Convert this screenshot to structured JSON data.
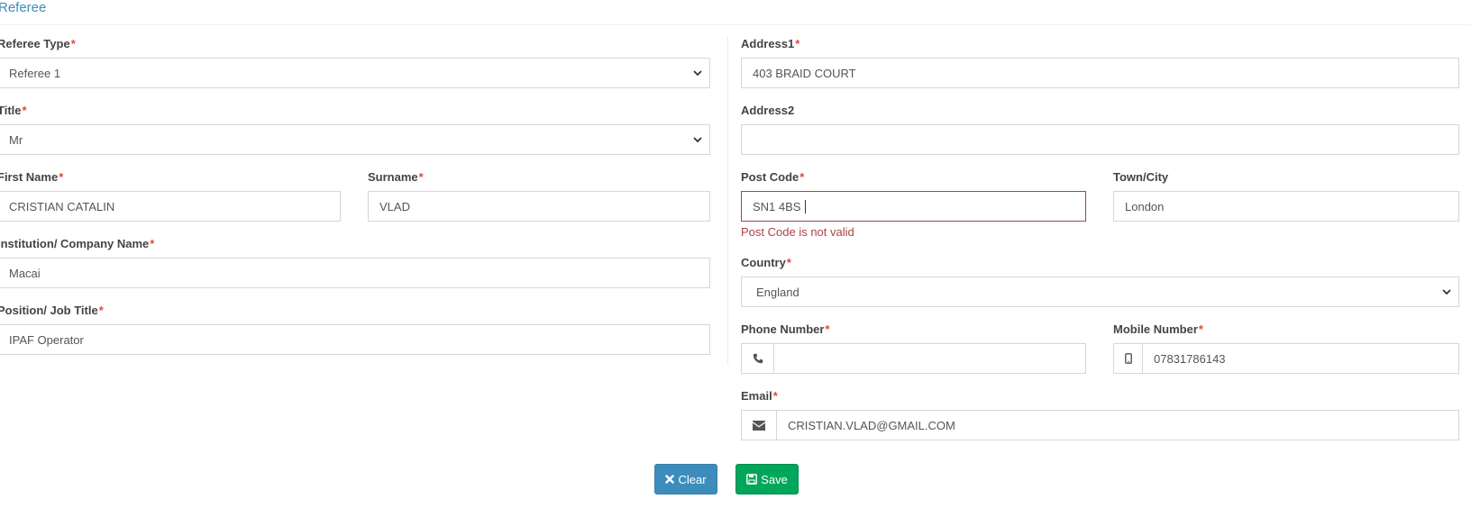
{
  "section": {
    "title": "Referee"
  },
  "required_mark": "*",
  "left": {
    "referee_type": {
      "label": "Referee Type",
      "value": "Referee 1"
    },
    "title": {
      "label": "Title",
      "value": "Mr"
    },
    "first_name": {
      "label": "First Name",
      "value": "CRISTIAN CATALIN"
    },
    "surname": {
      "label": "Surname",
      "value": "VLAD"
    },
    "company": {
      "label": "Institution/ Company Name",
      "value": "Macai"
    },
    "position": {
      "label": "Position/ Job Title",
      "value": "IPAF Operator"
    }
  },
  "right": {
    "address1": {
      "label": "Address1",
      "value": "403 BRAID COURT"
    },
    "address2": {
      "label": "Address2",
      "value": ""
    },
    "post_code": {
      "label": "Post Code",
      "value": "SN1 4BS",
      "error": "Post Code is not valid"
    },
    "town": {
      "label": "Town/City",
      "value": "London"
    },
    "country": {
      "label": "Country",
      "value": "England"
    },
    "phone": {
      "label": "Phone Number",
      "value": "",
      "icon": "phone-icon"
    },
    "mobile": {
      "label": "Mobile Number",
      "value": "07831786143",
      "icon": "mobile-icon"
    },
    "email": {
      "label": "Email",
      "value": "CRISTIAN.VLAD@GMAIL.COM",
      "icon": "envelope-icon"
    }
  },
  "buttons": {
    "clear": "Clear",
    "save": "Save"
  },
  "colors": {
    "primary": "#3c8dbc",
    "success": "#00a65a",
    "error": "#a94442",
    "required": "#dd4b39"
  }
}
